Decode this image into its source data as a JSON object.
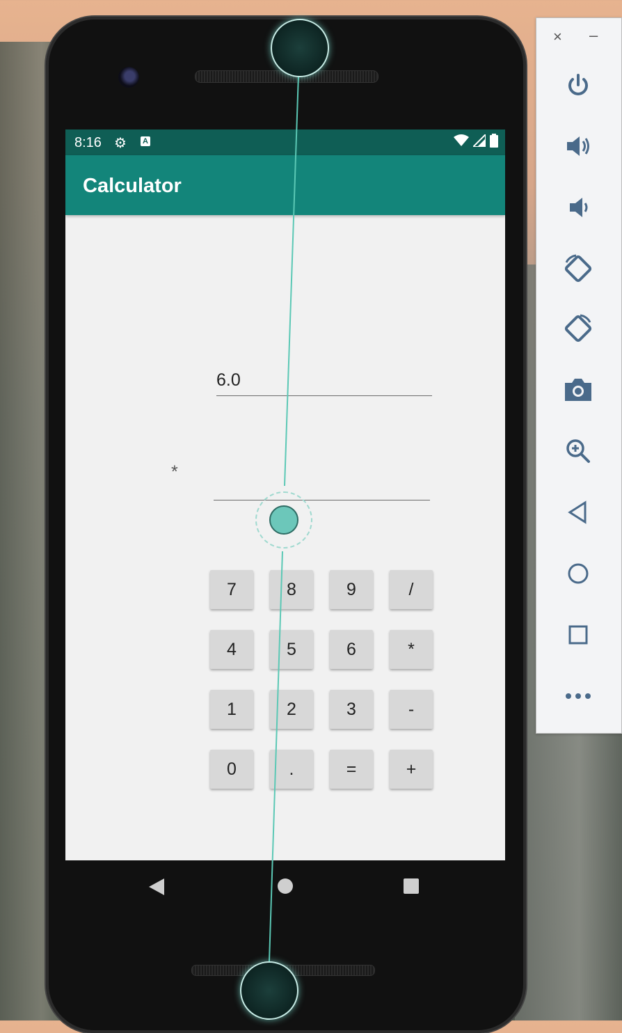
{
  "status_bar": {
    "time": "8:16"
  },
  "app_bar": {
    "title": "Calculator"
  },
  "calculator": {
    "first_operand": "6.0",
    "operator_label": "*",
    "second_operand": "",
    "keys": [
      "7",
      "8",
      "9",
      "/",
      "4",
      "5",
      "6",
      "*",
      "1",
      "2",
      "3",
      "-",
      "0",
      ".",
      "=",
      "+"
    ]
  },
  "emulator_panel": {
    "close": "×",
    "minimize": "–",
    "buttons": [
      "power-icon",
      "volume-up-icon",
      "volume-down-icon",
      "rotate-left-icon",
      "rotate-right-icon",
      "camera-icon",
      "zoom-icon",
      "back-icon",
      "home-icon",
      "overview-icon",
      "more-icon"
    ]
  },
  "colors": {
    "status_bar": "#0f5e55",
    "app_bar": "#13857a",
    "touch_accent": "#6cc7ba"
  }
}
